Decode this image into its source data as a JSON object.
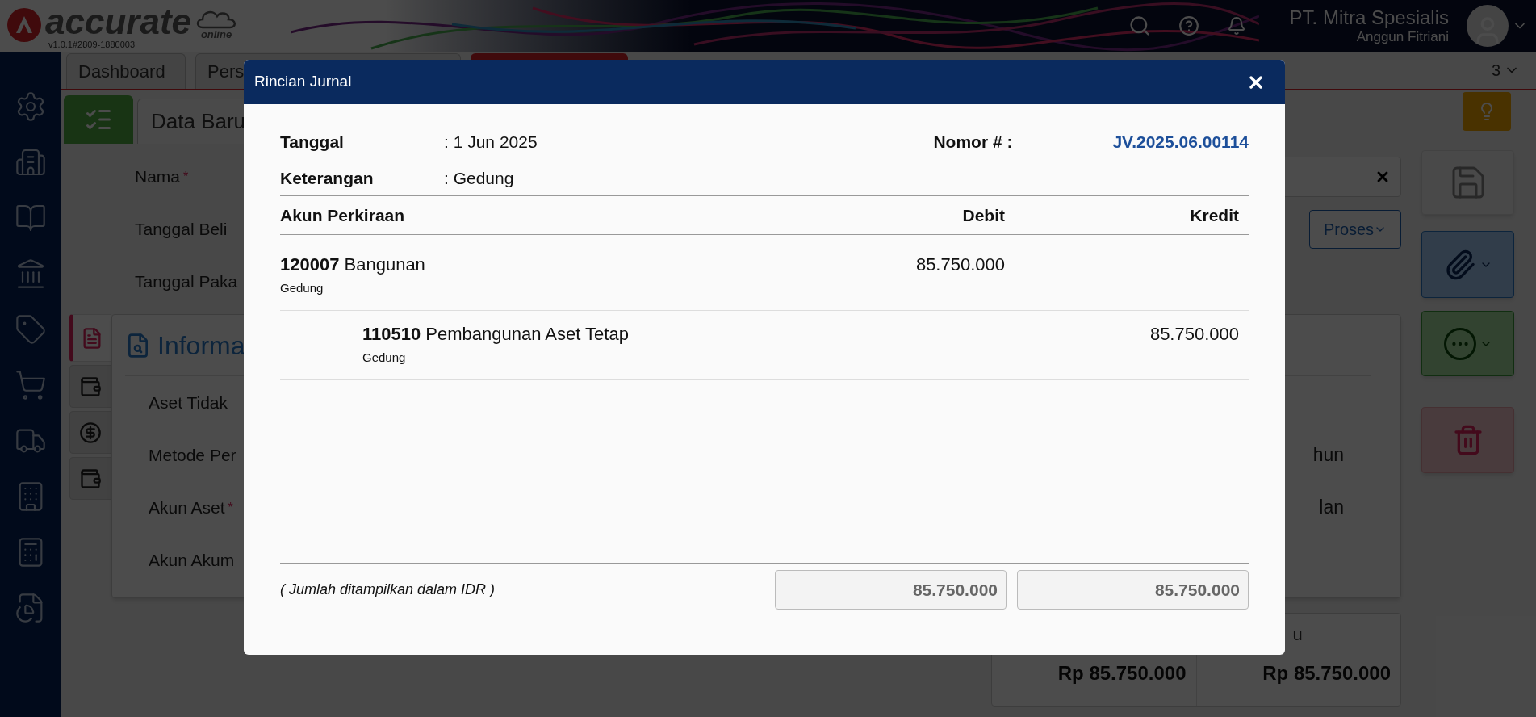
{
  "app_header": {
    "logo_text": "accurate",
    "logo_subtext": "online",
    "version": "v1.0.1#2809-1880003",
    "company": "PT. Mitra Spesialis",
    "user": "Anggun Fitriani"
  },
  "tabs": [
    {
      "label": "Dashboard",
      "selected": false
    },
    {
      "label": "Pers",
      "selected": false
    },
    {
      "selected": true
    }
  ],
  "tab_overflow": "3",
  "form": {
    "title": "Data Baru",
    "fields": [
      {
        "label": "Nama",
        "mark": "*"
      },
      {
        "label": "Tanggal Beli"
      },
      {
        "label": "Tanggal Paka"
      }
    ],
    "process_button": "Proses"
  },
  "info_panel": {
    "side_tabs": [
      {
        "selected": true
      },
      {
        "selected": false
      },
      {
        "selected": false
      },
      {
        "selected": false
      }
    ],
    "title": "Informa",
    "rows": [
      {
        "label": "Aset Tidak"
      },
      {
        "label": "Metode Per",
        "value_fragment": "hun"
      },
      {
        "label": "Akun Aset",
        "mark": "*",
        "value_fragment": "lan"
      },
      {
        "label": "Akun Akum"
      }
    ]
  },
  "summary": {
    "label_fragment": "u",
    "amounts": [
      "Rp 85.750.000",
      "Rp 85.750.000"
    ]
  },
  "dialog": {
    "title": "Rincian Jurnal",
    "date_label": "Tanggal",
    "date_value": ": 1 Jun 2025",
    "number_label": "Nomor # :",
    "number_value": "JV.2025.06.00114",
    "note_label": "Keterangan",
    "note_value": ": Gedung",
    "columns": [
      "Akun Perkiraan",
      "Debit",
      "Kredit"
    ],
    "rows": [
      {
        "kind": "debit",
        "account": "**120007** Bangunan",
        "memo": "Gedung",
        "amount": "85.750.000"
      },
      {
        "kind": "credit",
        "account": "**110510** Pembangunan Aset Tetap",
        "memo": "Gedung",
        "amount": "85.750.000"
      }
    ],
    "footer_note": "( Jumlah ditampilkan dalam IDR )",
    "totals": [
      "85.750.000",
      "85.750.000"
    ]
  }
}
